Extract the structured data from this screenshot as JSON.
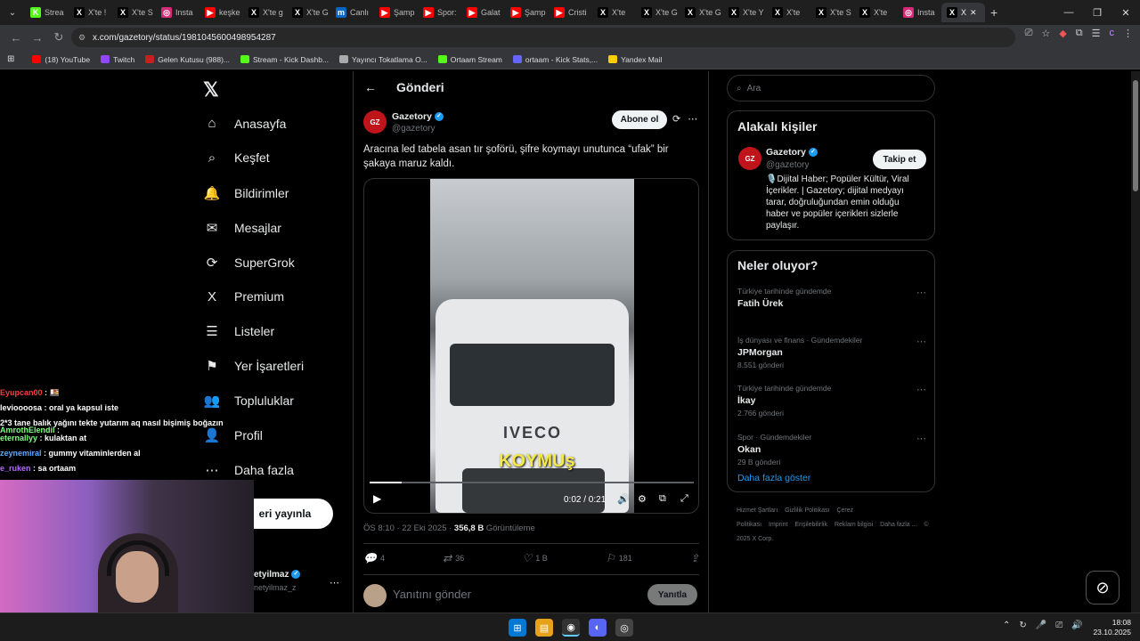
{
  "browser": {
    "tabs": [
      {
        "label": "Strea",
        "fav_color": "#53fc18",
        "fav_char": "K"
      },
      {
        "label": "X'te !",
        "fav_color": "#000000",
        "fav_char": "X"
      },
      {
        "label": "X'te S",
        "fav_color": "#000000",
        "fav_char": "X"
      },
      {
        "label": "Insta",
        "fav_color": "#d62976",
        "fav_char": "◎"
      },
      {
        "label": "keşke",
        "fav_color": "#ff0000",
        "fav_char": "▶"
      },
      {
        "label": "X'te g",
        "fav_color": "#000000",
        "fav_char": "X"
      },
      {
        "label": "X'te G",
        "fav_color": "#000000",
        "fav_char": "X"
      },
      {
        "label": "Canlı",
        "fav_color": "#0a66c2",
        "fav_char": "m"
      },
      {
        "label": "Şamp",
        "fav_color": "#ff0000",
        "fav_char": "▶"
      },
      {
        "label": "Spor:",
        "fav_color": "#ff0000",
        "fav_char": "▶"
      },
      {
        "label": "Galat",
        "fav_color": "#ff0000",
        "fav_char": "▶"
      },
      {
        "label": "Şamp",
        "fav_color": "#ff0000",
        "fav_char": "▶"
      },
      {
        "label": "Cristi",
        "fav_color": "#ff0000",
        "fav_char": "▶"
      },
      {
        "label": "X'te",
        "fav_color": "#000000",
        "fav_char": "X"
      },
      {
        "label": "X'te G",
        "fav_color": "#000000",
        "fav_char": "X"
      },
      {
        "label": "X'te G",
        "fav_color": "#000000",
        "fav_char": "X"
      },
      {
        "label": "X'te Y",
        "fav_color": "#000000",
        "fav_char": "X"
      },
      {
        "label": "X'te",
        "fav_color": "#000000",
        "fav_char": "X"
      },
      {
        "label": "X'te S",
        "fav_color": "#000000",
        "fav_char": "X"
      },
      {
        "label": "X'te",
        "fav_color": "#000000",
        "fav_char": "X"
      },
      {
        "label": "Insta",
        "fav_color": "#d62976",
        "fav_char": "◎"
      },
      {
        "label": "X",
        "fav_color": "#000000",
        "fav_char": "X",
        "active": true
      }
    ],
    "new_tab": "+",
    "url": "x.com/gazetory/status/1981045600498954287",
    "bookmarks": [
      {
        "label": "(18) YouTube",
        "color": "#ff0000"
      },
      {
        "label": "Twitch",
        "color": "#9146ff"
      },
      {
        "label": "Gelen Kutusu (988)...",
        "color": "#c5221f"
      },
      {
        "label": "Stream - Kick Dashb...",
        "color": "#53fc18"
      },
      {
        "label": "Yayıncı Tokatlama O...",
        "color": "#aaaaaa"
      },
      {
        "label": "Ortaam Stream",
        "color": "#53fc18"
      },
      {
        "label": "ortaam - Kick Stats,...",
        "color": "#6666ff"
      },
      {
        "label": "Yandex Mail",
        "color": "#ffcc00"
      }
    ]
  },
  "nav": {
    "items": [
      {
        "label": "Anasayfa",
        "icon": "⌂"
      },
      {
        "label": "Keşfet",
        "icon": "⌕"
      },
      {
        "label": "Bildirimler",
        "icon": "🔔"
      },
      {
        "label": "Mesajlar",
        "icon": "✉"
      },
      {
        "label": "SuperGrok",
        "icon": "⟳"
      },
      {
        "label": "Premium",
        "icon": "X"
      },
      {
        "label": "Listeler",
        "icon": "☰"
      },
      {
        "label": "Yer İşaretleri",
        "icon": "⚑"
      },
      {
        "label": "Topluluklar",
        "icon": "👥"
      },
      {
        "label": "Profil",
        "icon": "👤"
      },
      {
        "label": "Daha fazla",
        "icon": "⋯"
      }
    ],
    "post_button": "eri yayınla",
    "account_name": "etyilmaz",
    "account_handle": "netyilmaz_z"
  },
  "post": {
    "header": "Gönderi",
    "author_name": "Gazetory",
    "author_handle": "@gazetory",
    "avatar_text": "GZ",
    "subscribe": "Abone ol",
    "text": "Aracına led tabela asan tır şoförü, şifre koymayı unutunca “ufak” bir şakaya maruz kaldı.",
    "video": {
      "brand": "IVECO",
      "caption": "KOYMUş",
      "time": "0:02 / 0:21",
      "progress": 0.1
    },
    "time": "ÖS 8:10 · 22 Eki 2025 ·",
    "views": "356,8 B",
    "views_label": "Görüntüleme",
    "replies": "4",
    "reposts": "36",
    "likes": "1 B",
    "bookmarks": "181",
    "reply_placeholder": "Yanıtını gönder",
    "reply_button": "Yanıtla"
  },
  "sidebar": {
    "search_placeholder": "Ara",
    "related_title": "Alakalı kişiler",
    "related": {
      "name": "Gazetory",
      "handle": "@gazetory",
      "follow": "Takip et",
      "bio": "🎙️Dijital Haber; Popüler Kültür, Viral İçerikler. | Gazetory; dijital medyayı tarar, doğruluğundan emin olduğu haber ve popüler içerikleri sizlerle paylaşır."
    },
    "trends_title": "Neler oluyor?",
    "trends": [
      {
        "category": "Türkiye tarihinde gündemde",
        "name": "Fatih Ürek",
        "count": ""
      },
      {
        "category": "İş dünyası ve finans · Gündemdekiler",
        "name": "JPMorgan",
        "count": "8.551 gönderi"
      },
      {
        "category": "Türkiye tarihinde gündemde",
        "name": "İkay",
        "count": "2.766 gönderi"
      },
      {
        "category": "Spor · Gündemdekiler",
        "name": "Okan",
        "count": "29 B gönderi"
      }
    ],
    "show_more": "Daha fazla göster",
    "footer": [
      "Hizmet Şartları",
      "Gizlilik Politikası",
      "Çerez Politikası",
      "Imprint",
      "Erişilebilirlik",
      "Reklam bilgisi",
      "Daha fazla ...",
      "© 2025 X Corp."
    ]
  },
  "chat": [
    {
      "user": "Eyupcan00",
      "color": "#ff3b3b",
      "msg": ": 🍱"
    },
    {
      "user": "levioooosa",
      "color": "#ffffff",
      "msg": ": oral ya kapsul iste"
    },
    {
      "user": "",
      "color": "#ffffff",
      "msg": "2*3 tane balık yağını tekte yutarım aq nasıl bişimiş boğazın"
    },
    {
      "user": "AmrothElendil",
      "color": "#7fff7f",
      "msg": ":"
    },
    {
      "user": "eternallyy",
      "color": "#7fff7f",
      "msg": ": kulaktan at"
    },
    {
      "user": "zeynemiral",
      "color": "#5da9ff",
      "msg": ": gummy vitaminlerden al"
    },
    {
      "user": "e_ruken",
      "color": "#b469ff",
      "msg": ": sa ortaam"
    }
  ],
  "taskbar": {
    "time": "18:08",
    "date": "23.10.2025"
  }
}
